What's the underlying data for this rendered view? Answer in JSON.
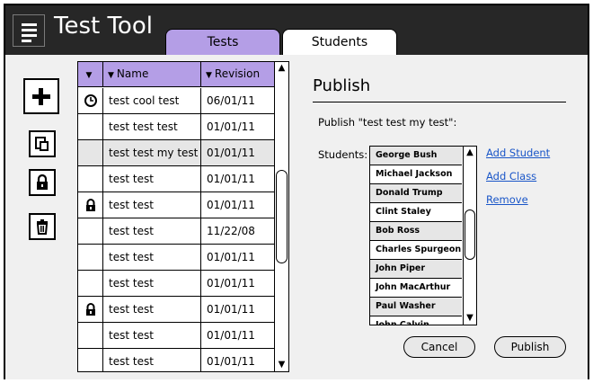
{
  "app": {
    "title": "Test Tool",
    "icon": "document-lines-icon"
  },
  "tabs": [
    {
      "label": "Tests",
      "active": true
    },
    {
      "label": "Students",
      "active": false
    }
  ],
  "colors": {
    "accent": "#b49ee6",
    "titlebar": "#272727",
    "selected_row": "#e6e6e6",
    "link": "#1a56c8"
  },
  "sidebar": {
    "buttons": [
      {
        "name": "add",
        "icon": "plus-icon"
      },
      {
        "name": "copy",
        "icon": "copy-icon"
      },
      {
        "name": "lock",
        "icon": "lock-icon"
      },
      {
        "name": "delete",
        "icon": "trash-icon"
      }
    ]
  },
  "table": {
    "headers": {
      "icon": "▼",
      "name": "Name",
      "revision": "Revision"
    },
    "rows": [
      {
        "icon": "clock-icon",
        "name": "test cool test",
        "revision": "06/01/11",
        "selected": false
      },
      {
        "icon": "",
        "name": "test test test",
        "revision": "01/01/11",
        "selected": false
      },
      {
        "icon": "",
        "name": "test test my test",
        "revision": "01/01/11",
        "selected": true
      },
      {
        "icon": "",
        "name": "test test",
        "revision": "01/01/11",
        "selected": false
      },
      {
        "icon": "lock-icon",
        "name": "test test",
        "revision": "01/01/11",
        "selected": false
      },
      {
        "icon": "",
        "name": "test test",
        "revision": "11/22/08",
        "selected": false
      },
      {
        "icon": "",
        "name": "test test",
        "revision": "01/01/11",
        "selected": false
      },
      {
        "icon": "",
        "name": "test test",
        "revision": "01/01/11",
        "selected": false
      },
      {
        "icon": "lock-icon",
        "name": "test test",
        "revision": "01/01/11",
        "selected": false
      },
      {
        "icon": "",
        "name": "test test",
        "revision": "01/01/11",
        "selected": false
      },
      {
        "icon": "",
        "name": "test test",
        "revision": "01/01/11",
        "selected": false
      }
    ]
  },
  "publish": {
    "title": "Publish",
    "subtitle": "Publish \"test test my test\":",
    "students_label": "Students:",
    "students": [
      "George Bush",
      "Michael Jackson",
      "Donald Trump",
      "Clint Staley",
      "Bob Ross",
      "Charles Spurgeon",
      "John Piper",
      "John MacArthur",
      "Paul Washer",
      "John Calvin"
    ],
    "links": {
      "add_student": "Add Student",
      "add_class": "Add Class",
      "remove": "Remove"
    },
    "cancel_label": "Cancel",
    "publish_label": "Publish"
  }
}
